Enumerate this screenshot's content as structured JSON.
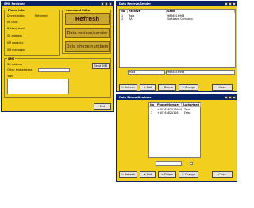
{
  "sms_receiver": {
    "title": "SMS Reciever",
    "phone_info": {
      "title": "Phone Info",
      "labels": [
        "Device status",
        "RF level",
        "Battery level",
        "SC address",
        "SM capacity",
        "SM messages"
      ],
      "device_status_value": "Returned"
    },
    "command_editor": {
      "title": "Command Editor",
      "refresh": "Refresh",
      "data_receive_sender": "Data recieve/sender",
      "data_phone_numbers": "Data phone numbers"
    },
    "sms": {
      "title": "SMS",
      "sc_address": "SC address",
      "other_end_address": "Other end address",
      "text": "Text",
      "send_sms": "Send SMS"
    },
    "exit": "Exit"
  },
  "data_receive_sender": {
    "title": "Data Recieve/Sender",
    "columns": [
      "No",
      "Recieve",
      "Send"
    ],
    "rows": [
      {
        "no": "1",
        "receive": "Raja",
        "send": "9636516964"
      },
      {
        "no": "2",
        "receive": "RA",
        "send": "Software Company"
      }
    ],
    "input_receive": "Raja",
    "input_send": "9636516964",
    "buttons": {
      "refresh": "Refresh",
      "add": "Add",
      "delete": "Delete",
      "change": "Change",
      "close": "Close"
    }
  },
  "data_phone_numbers": {
    "title": "Data Phone Numbers",
    "columns": [
      "No",
      "Phone Number",
      "Authorized"
    ],
    "rows": [
      {
        "no": "1",
        "phone": "+3016362016964",
        "authorized": "True"
      },
      {
        "no": "2",
        "phone": "+30163820316",
        "authorized": "False"
      }
    ],
    "buttons": {
      "refresh": "Refresh",
      "add": "Add",
      "delete": "Delete",
      "change": "Change",
      "close": "Close"
    }
  },
  "colors": {
    "window_bg": "#f2cf1e",
    "titlebar": "#0a246a",
    "big_button": "#c9a830",
    "big_button_text": "#3a1a00"
  }
}
